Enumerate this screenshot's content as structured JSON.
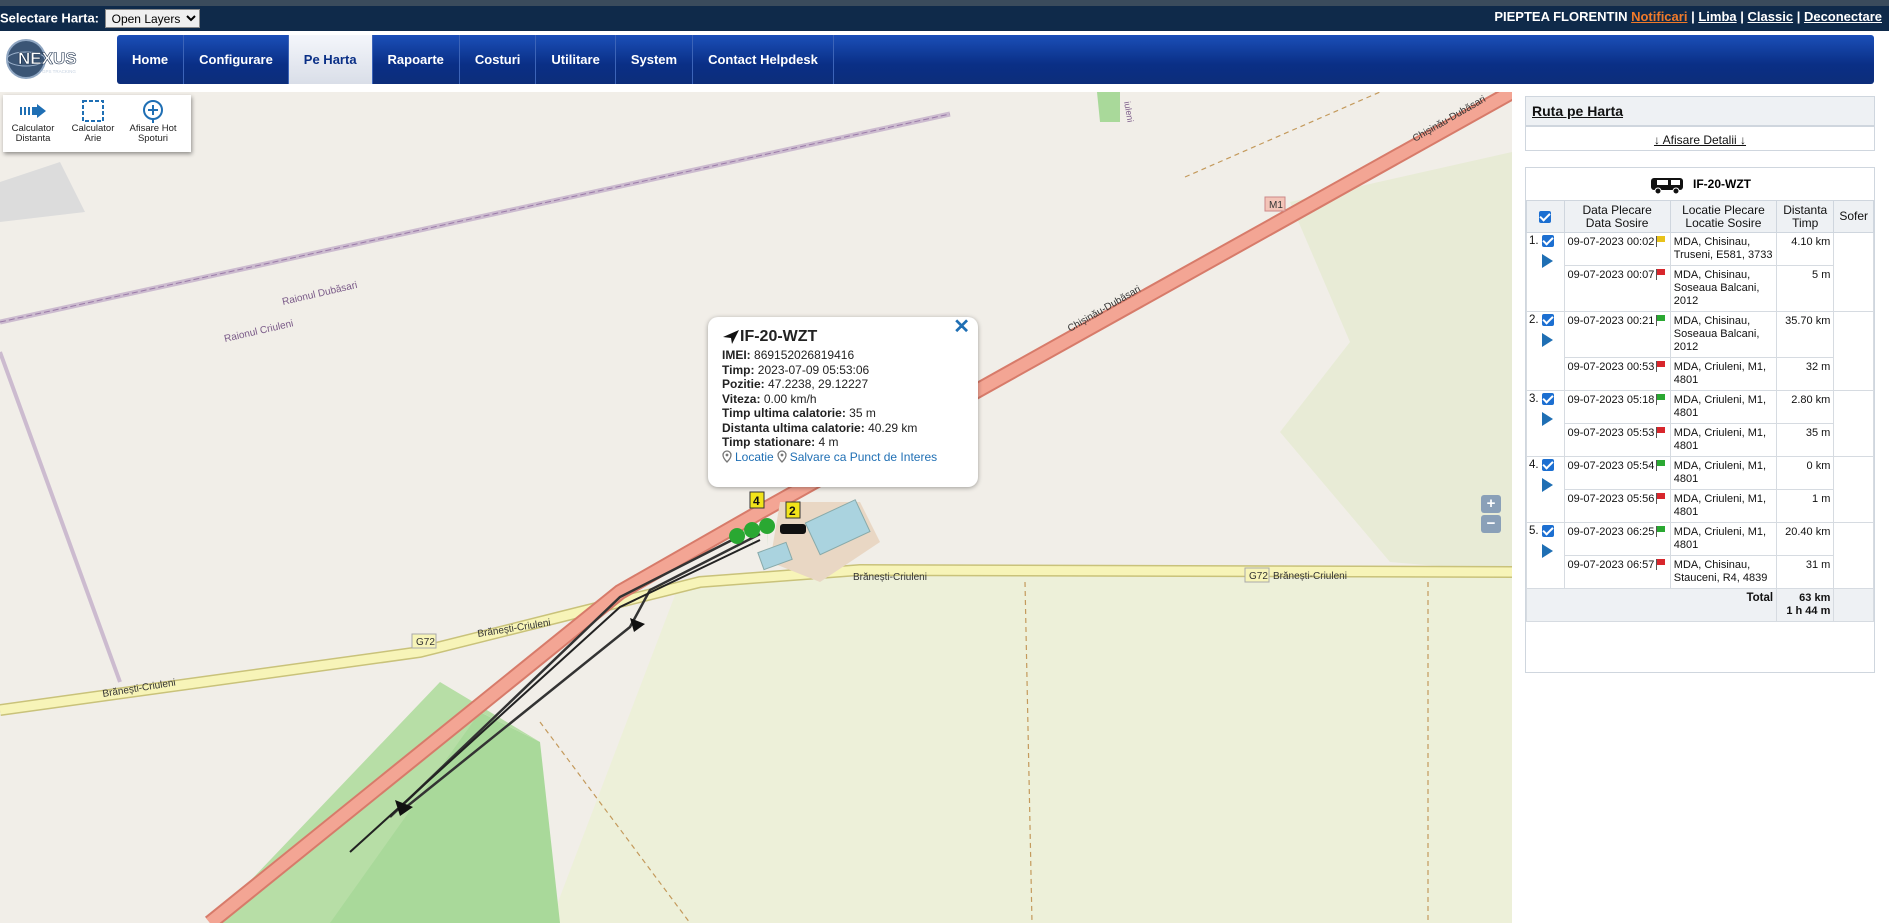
{
  "topbar": {
    "map_select_label": "Selectare Harta:",
    "map_select_value": "Open Layers",
    "user_name": "PIEPTEA FLORENTIN",
    "links": [
      "Notificari",
      "Limba",
      "Classic",
      "Deconectare"
    ],
    "separator": "|"
  },
  "nav": {
    "items": [
      "Home",
      "Configurare",
      "Pe Harta",
      "Rapoarte",
      "Costuri",
      "Utilitare",
      "System",
      "Contact Helpdesk"
    ],
    "active": "Pe Harta"
  },
  "tools": [
    {
      "label": "Calculator Distanta",
      "icon": "distance-arrow-icon"
    },
    {
      "label": "Calculator Arie",
      "icon": "area-select-icon"
    },
    {
      "label": "Afisare Hot Spoturi",
      "icon": "hotspot-plus-icon"
    }
  ],
  "map_labels": {
    "raionul_dubasari": "Raionul Dubăsari",
    "raionul_criuleni": "Raionul Criuleni",
    "chisinau_dubasari": "Chișinău-Dubăsari",
    "m1": "M1",
    "g72": "G72",
    "branesti_criuleni": "Brănești-Criuleni",
    "iuleni": "iuleni",
    "marker_4": "4",
    "marker_2": "2"
  },
  "popup": {
    "title": "IF-20-WZT",
    "rows": [
      {
        "label": "IMEI:",
        "value": "869152026819416"
      },
      {
        "label": "Timp:",
        "value": "2023-07-09 05:53:06"
      },
      {
        "label": "Pozitie:",
        "value": "47.2238, 29.12227"
      },
      {
        "label": "Viteza:",
        "value": "0.00 km/h"
      },
      {
        "label": "Timp ultima calatorie:",
        "value": "35 m"
      },
      {
        "label": "Distanta ultima calatorie:",
        "value": "40.29 km"
      },
      {
        "label": "Timp stationare:",
        "value": "4 m"
      }
    ],
    "link_location": "Locatie",
    "link_save": "Salvare ca Punct de Interes",
    "close": "✕"
  },
  "zoom": {
    "in": "+",
    "out": "−"
  },
  "panel": {
    "title": "Ruta pe Harta",
    "details_link": "↓ Afisare Detalii ↓",
    "vehicle": "IF-20-WZT",
    "headers": {
      "date": "Data Plecare\nData Sosire",
      "date1": "Data Plecare",
      "date2": "Data Sosire",
      "loc1": "Locatie Plecare",
      "loc2": "Locatie Sosire",
      "dist1": "Distanta",
      "dist2": "Timp",
      "sofer": "Sofer"
    },
    "trips": [
      {
        "idx": "1.",
        "dep_date": "09-07-2023 00:02",
        "dep_flag": "#e8c21a",
        "dep_loc": "MDA, Chisinau, Truseni, E581, 3733",
        "dist": "4.10 km",
        "arr_date": "09-07-2023 00:07",
        "arr_loc": "MDA, Chisinau, Soseaua Balcani, 2012",
        "time": "5 m"
      },
      {
        "idx": "2.",
        "dep_date": "09-07-2023 00:21",
        "dep_flag": "#2aa832",
        "dep_loc": "MDA, Chisinau, Soseaua Balcani, 2012",
        "dist": "35.70 km",
        "arr_date": "09-07-2023 00:53",
        "arr_loc": "MDA, Criuleni, M1, 4801",
        "time": "32 m"
      },
      {
        "idx": "3.",
        "dep_date": "09-07-2023 05:18",
        "dep_flag": "#2aa832",
        "dep_loc": "MDA, Criuleni, M1, 4801",
        "dist": "2.80 km",
        "arr_date": "09-07-2023 05:53",
        "arr_loc": "MDA, Criuleni, M1, 4801",
        "time": "35 m"
      },
      {
        "idx": "4.",
        "dep_date": "09-07-2023 05:54",
        "dep_flag": "#2aa832",
        "dep_loc": "MDA, Criuleni, M1, 4801",
        "dist": "0 km",
        "arr_date": "09-07-2023 05:56",
        "arr_loc": "MDA, Criuleni, M1, 4801",
        "time": "1 m"
      },
      {
        "idx": "5.",
        "dep_date": "09-07-2023 06:25",
        "dep_flag": "#2aa832",
        "dep_loc": "MDA, Criuleni, M1, 4801",
        "dist": "20.40 km",
        "arr_date": "09-07-2023 06:57",
        "arr_loc": "MDA, Chisinau, Stauceni, R4, 4839",
        "time": "31 m"
      }
    ],
    "total_label": "Total",
    "total_dist": "63 km",
    "total_time": "1 h 44 m",
    "arrival_flag": "#d8262c"
  }
}
